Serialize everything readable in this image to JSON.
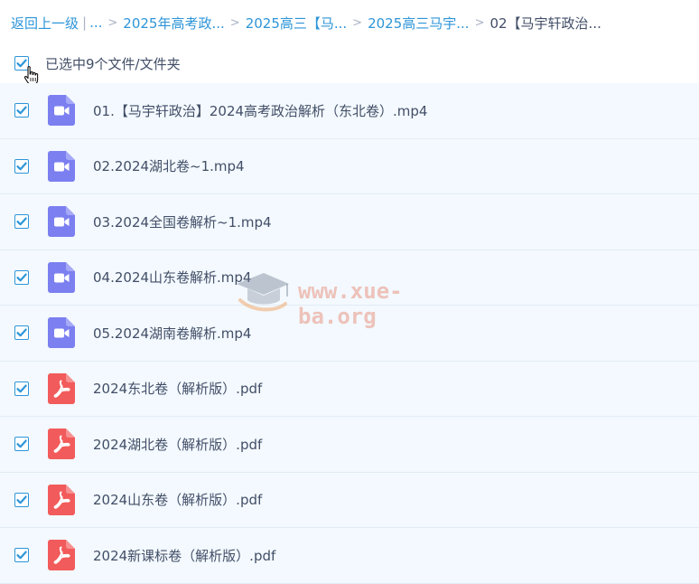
{
  "breadcrumb": {
    "back_label": "返回上一级",
    "ellipsis": "...",
    "items": [
      "2025年高考政...",
      "2025高三【马...",
      "2025高三马宇...",
      "02【马宇轩政治..."
    ]
  },
  "selection": {
    "label": "已选中9个文件/文件夹",
    "checked": true
  },
  "files": [
    {
      "name": "01.【马宇轩政治】2024高考政治解析（东北卷）.mp4",
      "type": "video",
      "checked": true
    },
    {
      "name": "02.2024湖北卷~1.mp4",
      "type": "video",
      "checked": true
    },
    {
      "name": "03.2024全国卷解析~1.mp4",
      "type": "video",
      "checked": true
    },
    {
      "name": "04.2024山东卷解析.mp4",
      "type": "video",
      "checked": true
    },
    {
      "name": "05.2024湖南卷解析.mp4",
      "type": "video",
      "checked": true
    },
    {
      "name": "2024东北卷（解析版）.pdf",
      "type": "pdf",
      "checked": true
    },
    {
      "name": "2024湖北卷（解析版）.pdf",
      "type": "pdf",
      "checked": true
    },
    {
      "name": "2024山东卷（解析版）.pdf",
      "type": "pdf",
      "checked": true
    },
    {
      "name": "2024新课标卷（解析版）.pdf",
      "type": "pdf",
      "checked": true
    }
  ],
  "icons": {
    "video": "video-file-icon",
    "pdf": "pdf-file-icon",
    "check": "check-icon",
    "cursor": "hand-cursor-icon"
  },
  "watermark": {
    "text": "www.xue-ba.org"
  },
  "colors": {
    "link": "#2d95d8",
    "text": "#424e67",
    "row_bg": "#f3f9fe",
    "video_icon": "#7b7ff0",
    "pdf_icon": "#f25b5b"
  }
}
